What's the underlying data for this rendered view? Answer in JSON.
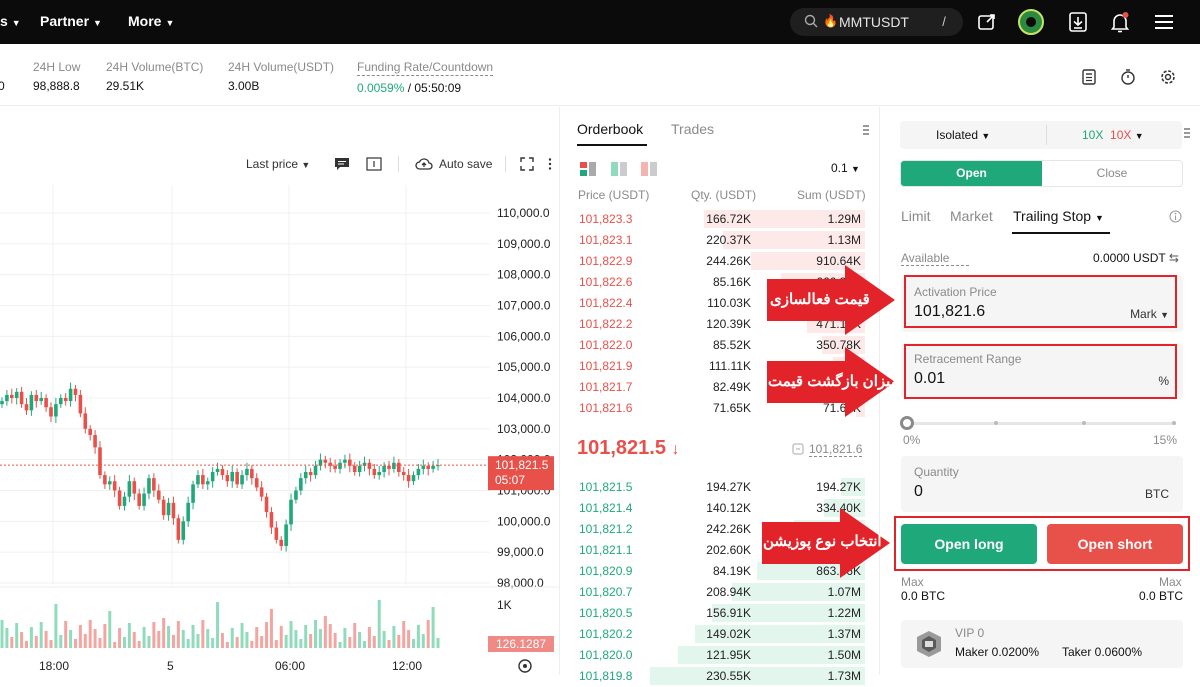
{
  "topbar": {
    "nav_partial": "s",
    "nav_partner": "Partner",
    "nav_more": "More",
    "search_value": "MMTUSDT",
    "search_shortcut": "/"
  },
  "ticker": {
    "partial_value": "0",
    "low_label": "24H Low",
    "low_value": "98,888.8",
    "vol_btc_label": "24H Volume(BTC)",
    "vol_btc_value": "29.51K",
    "vol_usdt_label": "24H Volume(USDT)",
    "vol_usdt_value": "3.00B",
    "funding_label": "Funding Rate/Countdown",
    "funding_rate": "0.0059%",
    "countdown": "/ 05:50:09"
  },
  "chart_toolbar": {
    "last_price": "Last price",
    "auto_save": "Auto save"
  },
  "chart_data": {
    "type": "candlestick",
    "y_ticks": [
      "110,000.0",
      "109,000.0",
      "108,000.0",
      "107,000.0",
      "106,000.0",
      "105,000.0",
      "104,000.0",
      "103,000.0",
      "102,000.0",
      "101,000.0",
      "100,000.0",
      "99,000.0",
      "98,000.0"
    ],
    "x_ticks": [
      "18:00",
      "5",
      "06:00",
      "12:00"
    ],
    "current_price": "101,821.5",
    "countdown": "05:07",
    "volume_tick": "1K",
    "volume_value": "126.1287",
    "close_series": [
      103900,
      104100,
      104000,
      104200,
      103800,
      103600,
      104100,
      103900,
      104000,
      103700,
      103400,
      103800,
      104000,
      103900,
      104300,
      104100,
      103500,
      103000,
      102800,
      102400,
      101500,
      101200,
      101300,
      101000,
      100500,
      100800,
      101300,
      100900,
      100500,
      100900,
      101400,
      101000,
      100700,
      100200,
      100600,
      100100,
      99400,
      100000,
      100600,
      101200,
      101500,
      101200,
      101300,
      101600,
      101700,
      101500,
      101300,
      101600,
      101200,
      101500,
      101700,
      101400,
      101100,
      100800,
      100300,
      99800,
      99400,
      99200,
      99900,
      100700,
      101000,
      101400,
      101600,
      101500,
      101800,
      102000,
      101900,
      101800,
      101700,
      101900,
      102000,
      101800,
      101600,
      101800,
      101900,
      101700,
      101500,
      101600,
      101800,
      101700,
      101900,
      101600,
      101500,
      101300,
      101500,
      101700,
      101800,
      101700,
      101800,
      101821
    ]
  },
  "orderbook": {
    "tab_orderbook": "Orderbook",
    "tab_trades": "Trades",
    "precision": "0.1",
    "col_price": "Price (USDT)",
    "col_qty": "Qty. (USDT)",
    "col_sum": "Sum (USDT)",
    "asks": [
      {
        "price": "101,823.3",
        "qty": "166.72K",
        "sum": "1.29M",
        "depth": 0.75
      },
      {
        "price": "101,823.1",
        "qty": "220.37K",
        "sum": "1.13M",
        "depth": 0.66
      },
      {
        "price": "101,822.9",
        "qty": "244.26K",
        "sum": "910.64K",
        "depth": 0.53
      },
      {
        "price": "101,822.6",
        "qty": "85.16K",
        "sum": "666.38K",
        "depth": 0.39
      },
      {
        "price": "101,822.4",
        "qty": "110.03K",
        "sum": "581.22K",
        "depth": 0.34
      },
      {
        "price": "101,822.2",
        "qty": "120.39K",
        "sum": "471.19K",
        "depth": 0.27
      },
      {
        "price": "101,822.0",
        "qty": "85.52K",
        "sum": "350.78K",
        "depth": 0.2
      },
      {
        "price": "101,821.9",
        "qty": "111.11K",
        "sum": "265.26K",
        "depth": 0.15
      },
      {
        "price": "101,821.7",
        "qty": "82.49K",
        "sum": "154.15K",
        "depth": 0.09
      },
      {
        "price": "101,821.6",
        "qty": "71.65K",
        "sum": "71.65K",
        "depth": 0.04
      }
    ],
    "mid_price": "101,821.5",
    "mid_arrow": "↓",
    "mark_price": "101,821.6",
    "bids": [
      {
        "price": "101,821.5",
        "qty": "194.27K",
        "sum": "194.27K",
        "depth": 0.11
      },
      {
        "price": "101,821.4",
        "qty": "140.12K",
        "sum": "334.40K",
        "depth": 0.19
      },
      {
        "price": "101,821.2",
        "qty": "242.26K",
        "sum": "576.66K",
        "depth": 0.33
      },
      {
        "price": "101,821.1",
        "qty": "202.60K",
        "sum": "779.26K",
        "depth": 0.45
      },
      {
        "price": "101,820.9",
        "qty": "84.19K",
        "sum": "863.46K",
        "depth": 0.5
      },
      {
        "price": "101,820.7",
        "qty": "208.94K",
        "sum": "1.07M",
        "depth": 0.62
      },
      {
        "price": "101,820.5",
        "qty": "156.91K",
        "sum": "1.22M",
        "depth": 0.71
      },
      {
        "price": "101,820.2",
        "qty": "149.02K",
        "sum": "1.37M",
        "depth": 0.79
      },
      {
        "price": "101,820.0",
        "qty": "121.95K",
        "sum": "1.50M",
        "depth": 0.87
      },
      {
        "price": "101,819.8",
        "qty": "230.55K",
        "sum": "1.73M",
        "depth": 1.0
      }
    ]
  },
  "trade_panel": {
    "margin_mode": "Isolated",
    "leverage_long": "10X",
    "leverage_short": "10X",
    "open": "Open",
    "close": "Close",
    "order_types": [
      "Limit",
      "Market",
      "Trailing Stop"
    ],
    "available_label": "Available",
    "available_value": "0.0000 USDT",
    "activation_label": "Activation Price",
    "activation_value": "101,821.6",
    "activation_unit": "Mark",
    "retracement_label": "Retracement Range",
    "retracement_value": "0.01",
    "retracement_unit": "%",
    "slider_min": "0%",
    "slider_max": "15%",
    "quantity_label": "Quantity",
    "quantity_value": "0",
    "quantity_unit": "BTC",
    "open_long": "Open long",
    "open_short": "Open short",
    "max_label_left": "Max",
    "max_value_left": "0.0 BTC",
    "max_label_right": "Max",
    "max_value_right": "0.0 BTC",
    "vip_label": "VIP 0",
    "maker_fee": "Maker 0.0200%",
    "taker_fee": "Taker 0.0600%"
  },
  "annotations": {
    "activation": "قیمت فعالسازی",
    "retracement": "میزان بازگشت قیمت",
    "position": "انتخاب نوع پوزیشن"
  },
  "colors": {
    "green": "#1fa97a",
    "red": "#e8504a",
    "annot_red": "#e3232a"
  }
}
